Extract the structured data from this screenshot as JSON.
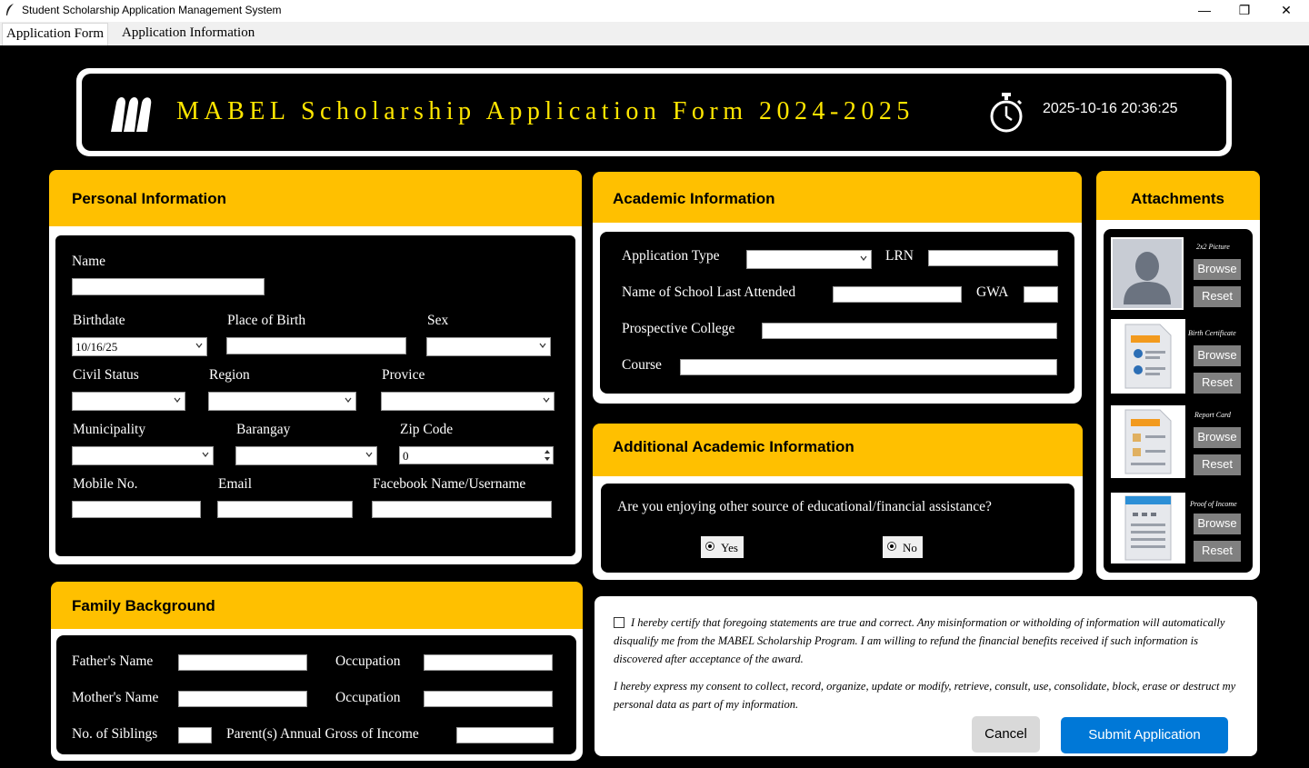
{
  "window": {
    "title": "Student Scholarship Application Management System",
    "minimize": "—",
    "maximize": "❐",
    "close": "✕"
  },
  "tabs": [
    "Application Form",
    "Application Information"
  ],
  "banner": {
    "title": "MABEL Scholarship Application Form 2024-2025",
    "datetime": "2025-10-16 20:36:25"
  },
  "personal": {
    "header": "Personal Information",
    "name_label": "Name",
    "birthdate_label": "Birthdate",
    "birthdate_value": "10/16/25",
    "place_of_birth_label": "Place of Birth",
    "sex_label": "Sex",
    "civil_status_label": "Civil Status",
    "region_label": "Region",
    "province_label": "Provice",
    "municipality_label": "Municipality",
    "barangay_label": "Barangay",
    "zip_label": "Zip Code",
    "zip_value": "0",
    "mobile_label": "Mobile No.",
    "email_label": "Email",
    "facebook_label": "Facebook Name/Username"
  },
  "academic": {
    "header": "Academic Information",
    "app_type_label": "Application Type",
    "lrn_label": "LRN",
    "school_label": "Name of School Last Attended",
    "gwa_label": "GWA",
    "college_label": "Prospective College",
    "course_label": "Course"
  },
  "additional": {
    "header": "Additional Academic Information",
    "question": "Are you enjoying other source of educational/financial assistance?",
    "yes": "Yes",
    "no": "No"
  },
  "attachments": {
    "header": "Attachments",
    "items": [
      {
        "label": "2x2 Picture",
        "icon": "person-silhouette-icon"
      },
      {
        "label": "Birth Certificate",
        "icon": "certificate-document-icon"
      },
      {
        "label": "Report Card",
        "icon": "report-card-document-icon"
      },
      {
        "label": "Proof of Income",
        "icon": "income-document-icon"
      }
    ],
    "browse": "Browse",
    "reset": "Reset"
  },
  "family": {
    "header": "Family Background",
    "father_label": "Father's Name",
    "occupation_label": "Occupation",
    "mother_label": "Mother's Name",
    "siblings_label": "No. of Siblings",
    "income_label": "Parent(s) Annual Gross of Income"
  },
  "certification": {
    "statement": "I hereby certify that foregoing statements are true and correct. Any misinformation or witholding of information will automatically disqualify me from the MABEL Scholarship Program. I am willing to refund the financial benefits received if such information is discovered after acceptance of the award.",
    "consent": "I hereby express my consent to collect, record, organize, update or modify, retrieve, consult, use, consolidate, block, erase or destruct my personal data as part of my information.",
    "cancel": "Cancel",
    "submit": "Submit Application"
  },
  "colors": {
    "header_yellow": "#ffc000",
    "title_yellow": "#ffe600",
    "submit_blue": "#0078d7"
  }
}
